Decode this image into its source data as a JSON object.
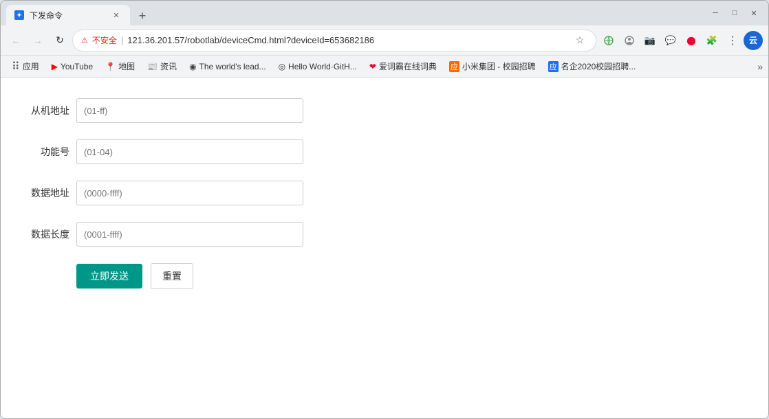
{
  "window": {
    "title": "下发命令",
    "controls": {
      "minimize": "─",
      "maximize": "□",
      "close": "✕"
    }
  },
  "toolbar": {
    "url": "121.36.201.57/robotlab/deviceCmd.html?deviceId=653682186",
    "security_label": "不安全",
    "separator": "|"
  },
  "bookmarks": {
    "apps_label": "应用",
    "items": [
      {
        "id": "youtube",
        "icon": "▶",
        "label": "YouTube"
      },
      {
        "id": "maps",
        "icon": "📍",
        "label": "地图"
      },
      {
        "id": "news",
        "icon": "📰",
        "label": "资讯"
      },
      {
        "id": "theworld",
        "icon": "◉",
        "label": "The world's lead..."
      },
      {
        "id": "github",
        "icon": "◎",
        "label": "Hello World·GitH..."
      },
      {
        "id": "dict",
        "icon": "❤",
        "label": "爱词霸在线词典"
      },
      {
        "id": "xiaomi",
        "icon": "应",
        "label": "小米集团 - 校园招聘"
      },
      {
        "id": "jobs",
        "icon": "应",
        "label": "名企2020校园招聘..."
      }
    ],
    "more": "»"
  },
  "form": {
    "fields": [
      {
        "id": "slave-address",
        "label": "从机地址",
        "placeholder": "(01-ff)"
      },
      {
        "id": "function-code",
        "label": "功能号",
        "placeholder": "(01-04)"
      },
      {
        "id": "data-address",
        "label": "数据地址",
        "placeholder": "(0000-ffff)"
      },
      {
        "id": "data-length",
        "label": "数据长度",
        "placeholder": "(0001-ffff)"
      }
    ],
    "submit_label": "立即发送",
    "reset_label": "重置"
  },
  "colors": {
    "submit_bg": "#009688",
    "security_color": "#d93025"
  }
}
